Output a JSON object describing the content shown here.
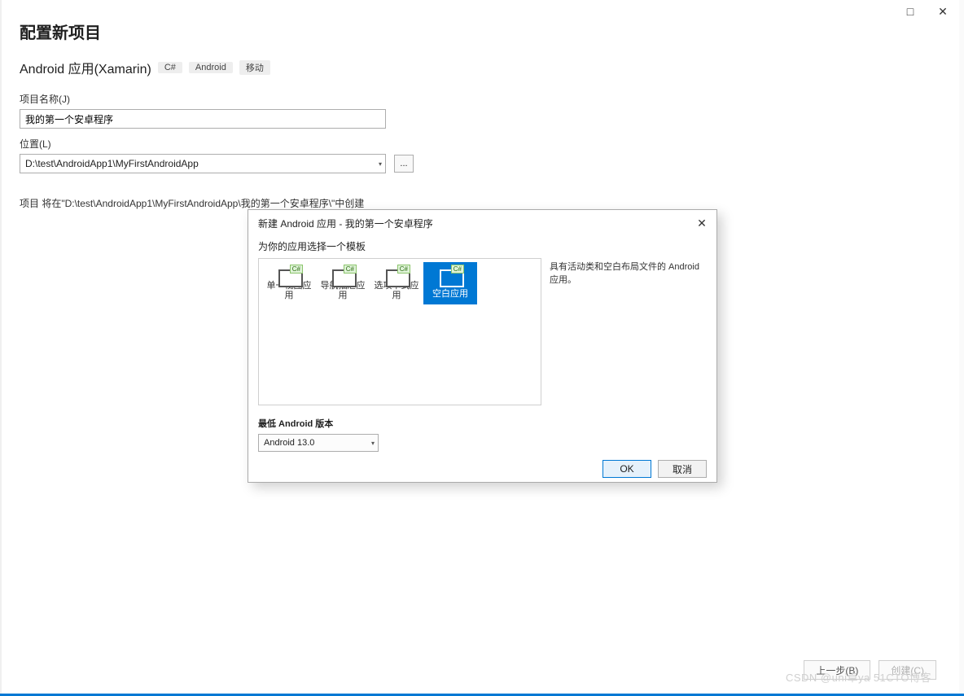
{
  "window": {
    "maximize_glyph": "□",
    "close_glyph": "✕"
  },
  "page": {
    "title": "配置新项目",
    "project_type": "Android 应用(Xamarin)",
    "tags": [
      "C#",
      "Android",
      "移动"
    ],
    "name_label": "项目名称(J)",
    "name_value": "我的第一个安卓程序",
    "location_label": "位置(L)",
    "location_value": "D:\\test\\AndroidApp1\\MyFirstAndroidApp",
    "browse_label": "...",
    "info_text": "项目 将在\"D:\\test\\AndroidApp1\\MyFirstAndroidApp\\我的第一个安卓程序\\\"中创建"
  },
  "footer": {
    "back": "上一步(B)",
    "create": "创建(C)"
  },
  "modal": {
    "title": "新建 Android 应用 - 我的第一个安卓程序",
    "instruction": "为你的应用选择一个模板",
    "templates": [
      {
        "label": "单一视图应用"
      },
      {
        "label": "导航抽屉应用"
      },
      {
        "label": "选项卡式应用"
      },
      {
        "label": "空白应用"
      }
    ],
    "selected_index": 3,
    "description": "具有活动类和空白布局文件的 Android 应用。",
    "min_version_label": "最低 Android 版本",
    "min_version_value": "Android 13.0",
    "ok": "OK",
    "cancel": "取消"
  },
  "watermark": "CSDN @uni卓ya  51CTO博客"
}
